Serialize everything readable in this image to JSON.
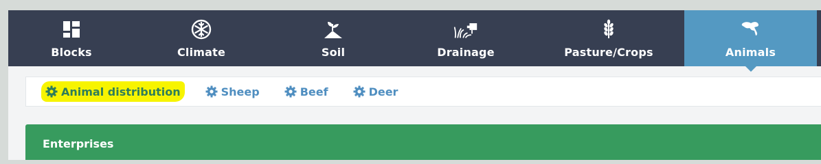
{
  "nav": {
    "items": [
      {
        "label": "Blocks",
        "icon": "blocks-icon"
      },
      {
        "label": "Climate",
        "icon": "snowflake-icon"
      },
      {
        "label": "Soil",
        "icon": "soil-sprout-icon"
      },
      {
        "label": "Drainage",
        "icon": "drainage-icon"
      },
      {
        "label": "Pasture/Crops",
        "icon": "wheat-icon"
      },
      {
        "label": "Animals",
        "icon": "animals-icon"
      }
    ],
    "active": "Animals"
  },
  "subnav": {
    "items": [
      {
        "label": "Animal distribution",
        "icon": "gear-icon"
      },
      {
        "label": "Sheep",
        "icon": "gear-icon"
      },
      {
        "label": "Beef",
        "icon": "gear-icon"
      },
      {
        "label": "Deer",
        "icon": "gear-icon"
      }
    ]
  },
  "section": {
    "title": "Enterprises"
  },
  "colors": {
    "nav_bg": "#373f52",
    "active_tab": "#5499c2",
    "link": "#4f8ec0",
    "highlight": "#f7f400",
    "section_bg": "#379b5e"
  }
}
